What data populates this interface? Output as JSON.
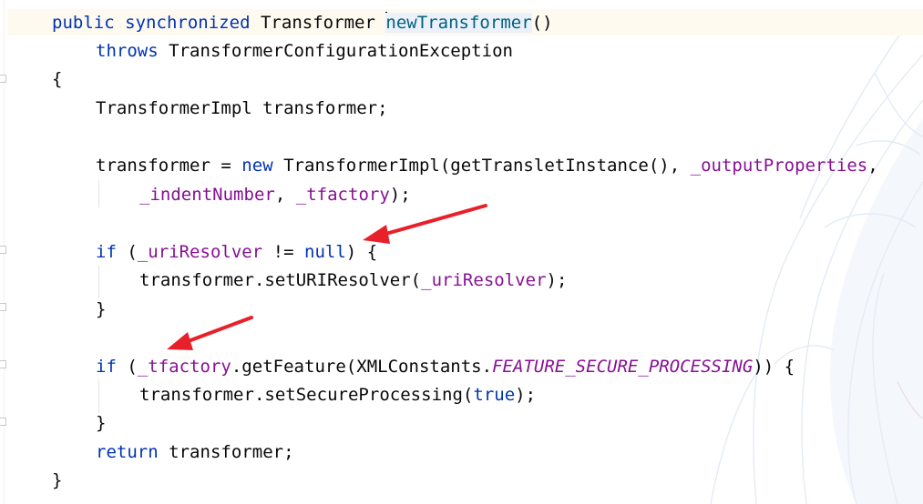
{
  "editor": {
    "lines": [
      {
        "segments": [
          {
            "t": "public synchronized",
            "c": "kw"
          },
          {
            "t": " Transformer ",
            "c": ""
          },
          {
            "t": "newTransformer",
            "c": "method-hl",
            "caret": true
          },
          {
            "t": "()",
            "c": ""
          }
        ]
      },
      {
        "segments": [
          {
            "t": "throws",
            "c": "kw"
          },
          {
            "t": " TransformerConfigurationException",
            "c": ""
          }
        ]
      },
      {
        "segments": [
          {
            "t": "{",
            "c": ""
          }
        ]
      },
      {
        "segments": [
          {
            "t": "TransformerImpl transformer;",
            "c": ""
          }
        ]
      },
      {
        "segments": []
      },
      {
        "segments": [
          {
            "t": "transformer = ",
            "c": ""
          },
          {
            "t": "new",
            "c": "kw"
          },
          {
            "t": " TransformerImpl(getTransletInstance(), ",
            "c": ""
          },
          {
            "t": "_outputProperties",
            "c": "field"
          },
          {
            "t": ",",
            "c": ""
          }
        ]
      },
      {
        "segments": [
          {
            "t": "_indentNumber",
            "c": "field"
          },
          {
            "t": ", ",
            "c": ""
          },
          {
            "t": "_tfactory",
            "c": "field"
          },
          {
            "t": ");",
            "c": ""
          }
        ]
      },
      {
        "segments": []
      },
      {
        "segments": [
          {
            "t": "if",
            "c": "kw"
          },
          {
            "t": " (",
            "c": ""
          },
          {
            "t": "_uriResolver",
            "c": "field"
          },
          {
            "t": " != ",
            "c": ""
          },
          {
            "t": "null",
            "c": "kw"
          },
          {
            "t": ") {",
            "c": ""
          }
        ]
      },
      {
        "segments": [
          {
            "t": "transformer.setURIResolver(",
            "c": ""
          },
          {
            "t": "_uriResolver",
            "c": "field"
          },
          {
            "t": ");",
            "c": ""
          }
        ]
      },
      {
        "segments": [
          {
            "t": "}",
            "c": ""
          }
        ]
      },
      {
        "segments": []
      },
      {
        "segments": [
          {
            "t": "if",
            "c": "kw"
          },
          {
            "t": " (",
            "c": ""
          },
          {
            "t": "_tfactory",
            "c": "field"
          },
          {
            "t": ".getFeature(XMLConstants.",
            "c": ""
          },
          {
            "t": "FEATURE_SECURE_PROCESSING",
            "c": "const"
          },
          {
            "t": ")) {",
            "c": ""
          }
        ]
      },
      {
        "segments": [
          {
            "t": "transformer.setSecureProcessing(",
            "c": ""
          },
          {
            "t": "true",
            "c": "kw"
          },
          {
            "t": ");",
            "c": ""
          }
        ]
      },
      {
        "segments": [
          {
            "t": "}",
            "c": ""
          }
        ]
      },
      {
        "segments": [
          {
            "t": "return",
            "c": "kw"
          },
          {
            "t": " transformer;",
            "c": ""
          }
        ]
      },
      {
        "segments": [
          {
            "t": "}",
            "c": ""
          }
        ]
      }
    ]
  },
  "colors": {
    "keyword": "#0033b3",
    "field": "#871094",
    "method_highlight_bg": "#ebf0fb",
    "caret_row_bg": "#fefaf0",
    "annotation_arrow": "#e8202a"
  },
  "annotations": [
    {
      "type": "red-arrow",
      "points_to": "null"
    },
    {
      "type": "red-arrow",
      "points_to": "_tfactory"
    }
  ]
}
